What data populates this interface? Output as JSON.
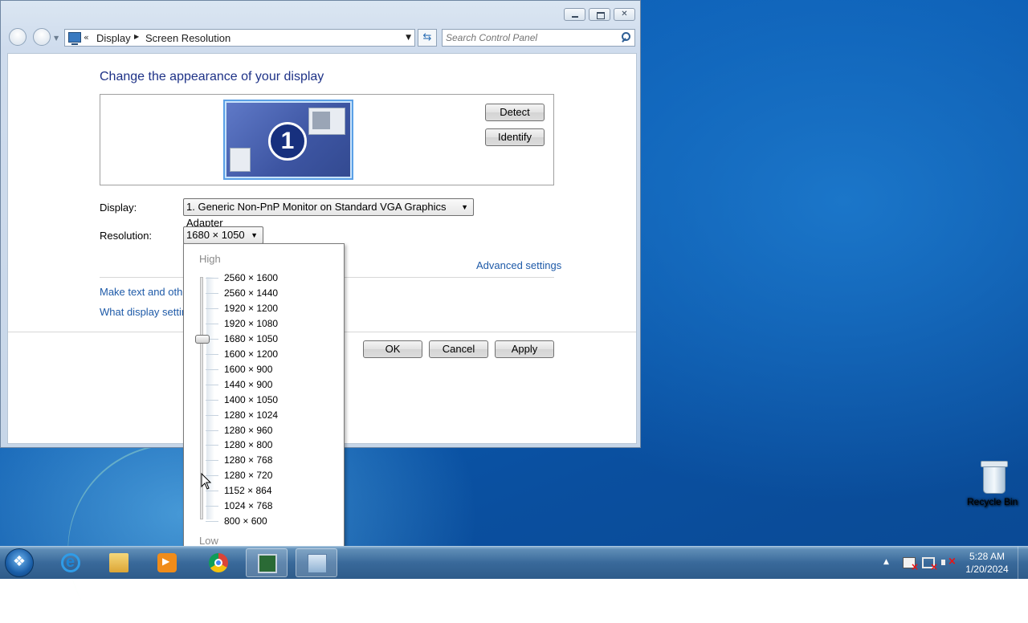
{
  "window": {
    "address": {
      "crumbs": [
        "Display",
        "Screen Resolution"
      ],
      "chevron": "«"
    },
    "search_placeholder": "Search Control Panel",
    "refresh_icon": "refresh-icon"
  },
  "content": {
    "title": "Change the appearance of your display",
    "monitor_number": "1",
    "detect_label": "Detect",
    "identify_label": "Identify",
    "display_label": "Display:",
    "display_value": "1. Generic Non-PnP Monitor on Standard VGA Graphics Adapter",
    "resolution_label": "Resolution:",
    "resolution_value": "1680 × 1050",
    "advanced_link": "Advanced settings",
    "link_text_size": "Make text and other",
    "link_what": "What display setting",
    "ok_label": "OK",
    "cancel_label": "Cancel",
    "apply_label": "Apply"
  },
  "resolution_popup": {
    "high_label": "High",
    "low_label": "Low",
    "selected_index": 4,
    "options": [
      "2560 × 1600",
      "2560 × 1440",
      "1920 × 1200",
      "1920 × 1080",
      "1680 × 1050",
      "1600 × 1200",
      "1600 × 900",
      "1440 × 900",
      "1400 × 1050",
      "1280 × 1024",
      "1280 × 960",
      "1280 × 800",
      "1280 × 768",
      "1280 × 720",
      "1152 × 864",
      "1024 × 768",
      "800 × 600"
    ]
  },
  "desktop": {
    "recycle_bin_label": "Recycle Bin"
  },
  "taskbar": {
    "apps": [
      "internet-explorer",
      "windows-explorer",
      "media-player",
      "google-chrome",
      "display-settings",
      "control-panel"
    ],
    "clock_time": "5:28 AM",
    "clock_date": "1/20/2024"
  }
}
